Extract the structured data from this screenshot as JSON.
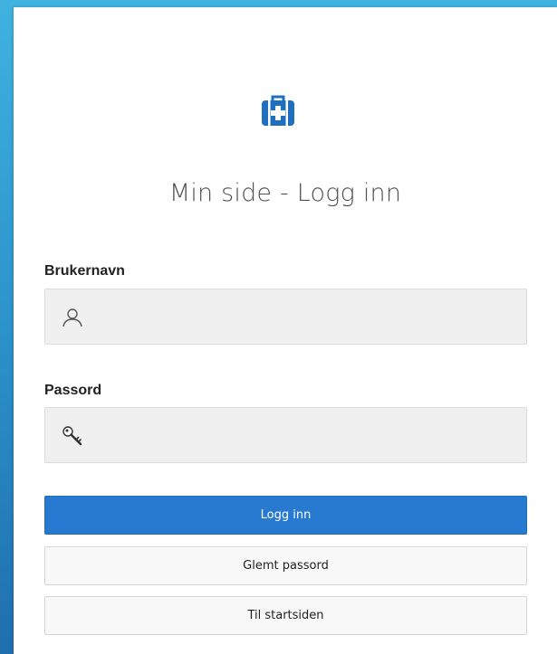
{
  "login": {
    "title": "Min side - Logg inn",
    "username_label": "Brukernavn",
    "username_value": "",
    "password_label": "Passord",
    "password_value": "",
    "login_button": "Logg inn",
    "forgot_button": "Glemt passord",
    "home_button": "Til startsiden"
  },
  "icons": {
    "logo": "medical-kit-icon",
    "username": "user-icon",
    "password": "key-icon"
  },
  "colors": {
    "background_top": "#3fb2e0",
    "background_bottom": "#1f6fb0",
    "primary": "#2879d0",
    "logo": "#1f6fbf"
  }
}
